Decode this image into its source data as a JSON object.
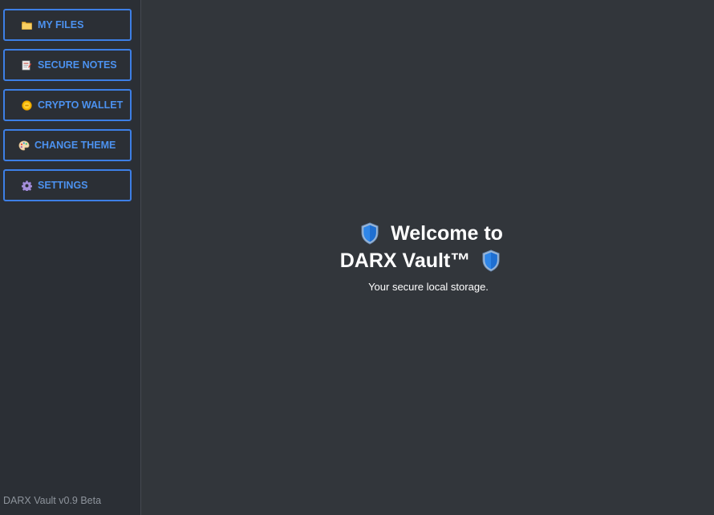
{
  "sidebar": {
    "items": [
      {
        "label": "MY FILES",
        "icon": "folder-icon"
      },
      {
        "label": "SECURE NOTES",
        "icon": "note-icon"
      },
      {
        "label": "CRYPTO WALLET",
        "icon": "coin-icon"
      },
      {
        "label": "CHANGE THEME",
        "icon": "palette-icon"
      },
      {
        "label": "SETTINGS",
        "icon": "gear-icon"
      }
    ],
    "version": "DARX Vault v0.9 Beta"
  },
  "main": {
    "title_line1": "Welcome to",
    "title_line2": "DARX Vault™",
    "subtitle": "Your secure local storage."
  },
  "colors": {
    "accent": "#3d7fe6",
    "sidebar_bg": "#2b2f35",
    "main_bg": "#32363b"
  }
}
